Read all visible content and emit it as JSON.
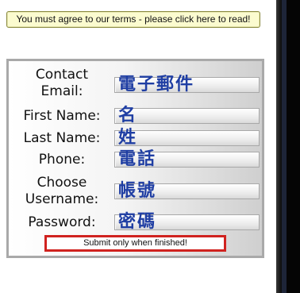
{
  "terms": {
    "link_text": "You must agree to our terms - please click here to read!"
  },
  "form": {
    "fields": [
      {
        "label": "Contact Email:",
        "placeholder": "電子郵件"
      },
      {
        "label": "First Name:",
        "placeholder": "名"
      },
      {
        "label": "Last Name:",
        "placeholder": "姓"
      },
      {
        "label": "Phone:",
        "placeholder": "電話"
      },
      {
        "label": "Choose Username:",
        "placeholder": "帳號"
      },
      {
        "label": "Password:",
        "placeholder": "密碼"
      }
    ],
    "submit_label": "Submit only when finished!"
  },
  "colors": {
    "terms_bg": "#fbfbcf",
    "placeholder_text": "#1f3ea3",
    "submit_border": "#d0221f"
  }
}
